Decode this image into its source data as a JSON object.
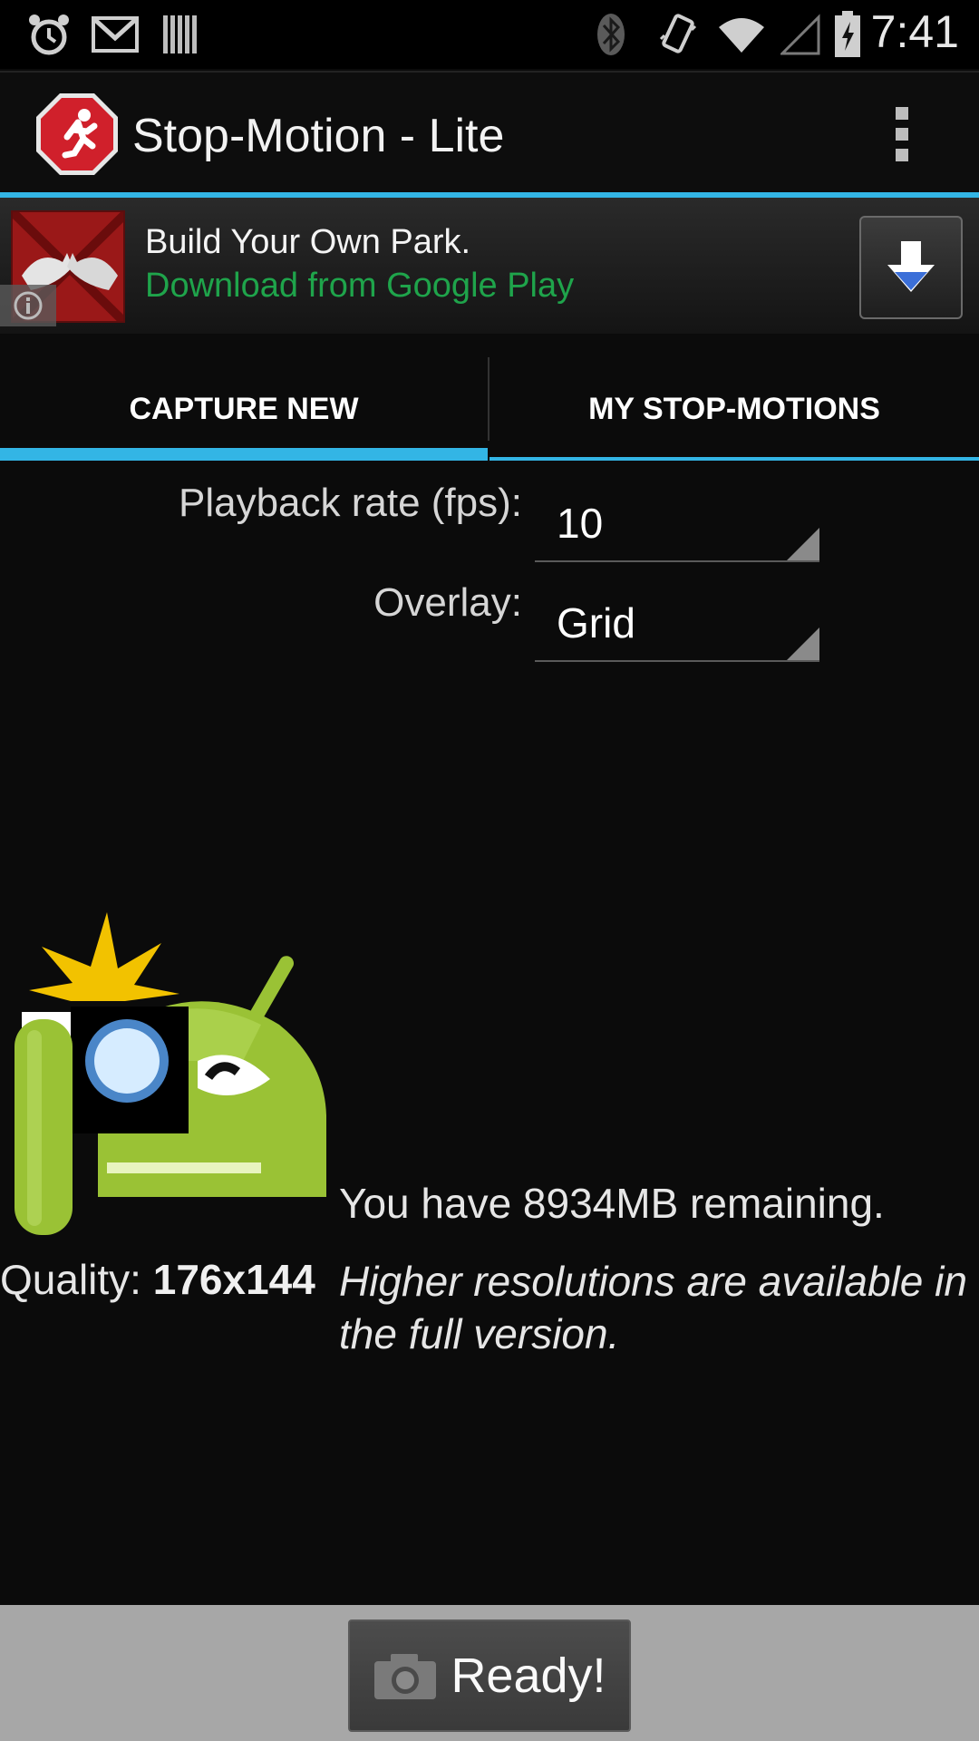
{
  "status_bar": {
    "time": "7:41",
    "icons": [
      "alarm-icon",
      "gmail-icon",
      "barcode-icon",
      "bluetooth-icon",
      "vibrate-icon",
      "wifi-icon",
      "signal-icon",
      "battery-icon"
    ]
  },
  "app_bar": {
    "title": "Stop-Motion - Lite",
    "logo_icon": "stop-sign-runner-icon",
    "overflow_icon": "overflow-menu-icon"
  },
  "ad": {
    "title": "Build Your Own Park.",
    "subtitle": "Download from Google Play",
    "subtitle_color": "#1fa44b",
    "thumb_icon": "dinosaur-app-icon",
    "info_icon": "info-icon",
    "download_icon": "download-arrow-icon"
  },
  "tabs": [
    {
      "label": "CAPTURE NEW",
      "selected": true
    },
    {
      "label": "MY STOP-MOTIONS",
      "selected": false
    }
  ],
  "accent_color": "#33b5e5",
  "form": {
    "playback_label": "Playback rate (fps):",
    "playback_value": "10",
    "overlay_label": "Overlay:",
    "overlay_value": "Grid"
  },
  "info": {
    "remaining": "You have 8934MB remaining.",
    "quality_label": "Quality:",
    "quality_value": "176x144",
    "note": "Higher resolutions are available in the full version."
  },
  "bottom": {
    "ready_label": "Ready!",
    "camera_icon": "camera-icon"
  }
}
